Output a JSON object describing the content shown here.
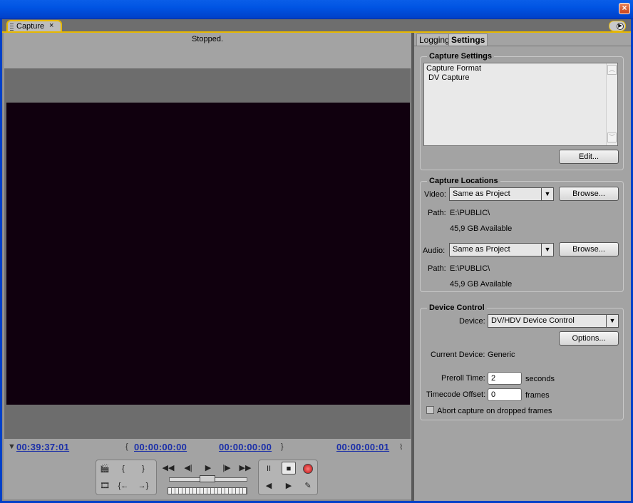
{
  "window": {
    "close_glyph": "×"
  },
  "panel_tab": {
    "title": "Capture",
    "close_glyph": "×"
  },
  "monitor": {
    "status": "Stopped.",
    "timecodes": {
      "current": "00:39:37:01",
      "in_point": "00:00:00:00",
      "out_point": "00:00:00:00",
      "duration": "00:00:00:01"
    }
  },
  "transport": {
    "rewind": "◀◀",
    "step_back": "◀|",
    "play": "▶",
    "step_forward": "|▶",
    "fast_forward": "▶▶",
    "pause": "II",
    "stop": "■",
    "slow_reverse": "◀",
    "slow_play": "▶",
    "set_in": "{",
    "set_out": "}",
    "goto_in": "{←",
    "goto_out": "→}"
  },
  "right_panel": {
    "tabs": [
      "Logging",
      "Settings"
    ],
    "capture_settings": {
      "legend": "Capture Settings",
      "lines": [
        "Capture Format",
        " DV Capture"
      ],
      "edit_button": "Edit..."
    },
    "capture_locations": {
      "legend": "Capture Locations",
      "video_label": "Video:",
      "video_value": "Same as Project",
      "video_browse": "Browse...",
      "video_path_label": "Path:",
      "video_path": "E:\\PUBLIC\\",
      "video_available": "45,9 GB Available",
      "audio_label": "Audio:",
      "audio_value": "Same as Project",
      "audio_browse": "Browse...",
      "audio_path_label": "Path:",
      "audio_path": "E:\\PUBLIC\\",
      "audio_available": "45,9 GB Available"
    },
    "device_control": {
      "legend": "Device Control",
      "device_label": "Device:",
      "device_value": "DV/HDV Device Control",
      "options_button": "Options...",
      "current_device_label": "Current Device:",
      "current_device_value": "Generic",
      "preroll_label": "Preroll Time:",
      "preroll_value": "2",
      "preroll_unit": "seconds",
      "offset_label": "Timecode Offset:",
      "offset_value": "0",
      "offset_unit": "frames",
      "abort_label": "Abort capture on dropped frames",
      "abort_checked": false
    }
  }
}
